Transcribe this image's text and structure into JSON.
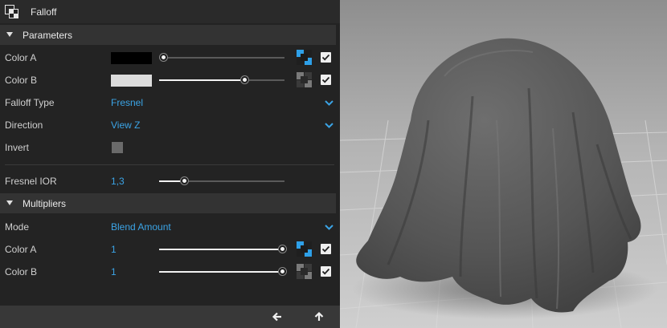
{
  "title": "Falloff",
  "sections": {
    "parameters": "Parameters",
    "multipliers": "Multipliers"
  },
  "parameters": {
    "color_a": {
      "label": "Color A",
      "swatch": "#000000",
      "slider_value": 0.0,
      "map_active": true,
      "enabled": true
    },
    "color_b": {
      "label": "Color B",
      "swatch": "#dcdcdc",
      "slider_value": 0.68,
      "map_active": false,
      "enabled": true
    },
    "falloff_type": {
      "label": "Falloff Type",
      "value": "Fresnel"
    },
    "direction": {
      "label": "Direction",
      "value": "View Z"
    },
    "invert": {
      "label": "Invert",
      "checked": false
    },
    "fresnel_ior": {
      "label": "Fresnel IOR",
      "value": "1,3",
      "slider_value": 0.2
    }
  },
  "multipliers": {
    "mode": {
      "label": "Mode",
      "value": "Blend Amount"
    },
    "color_a": {
      "label": "Color A",
      "value": "1",
      "slider_value": 1.0,
      "map_active": true,
      "enabled": true
    },
    "color_b": {
      "label": "Color B",
      "value": "1",
      "slider_value": 1.0,
      "map_active": false,
      "enabled": true
    }
  },
  "footer": {
    "back_icon": "arrow-left-icon",
    "up_icon": "arrow-up-icon"
  },
  "colors": {
    "accent": "#3ba4e6",
    "panel_bg": "#232323",
    "section_bg": "#333333",
    "footer_bg": "#383838"
  },
  "preview": {
    "description_icon": "render-preview"
  }
}
